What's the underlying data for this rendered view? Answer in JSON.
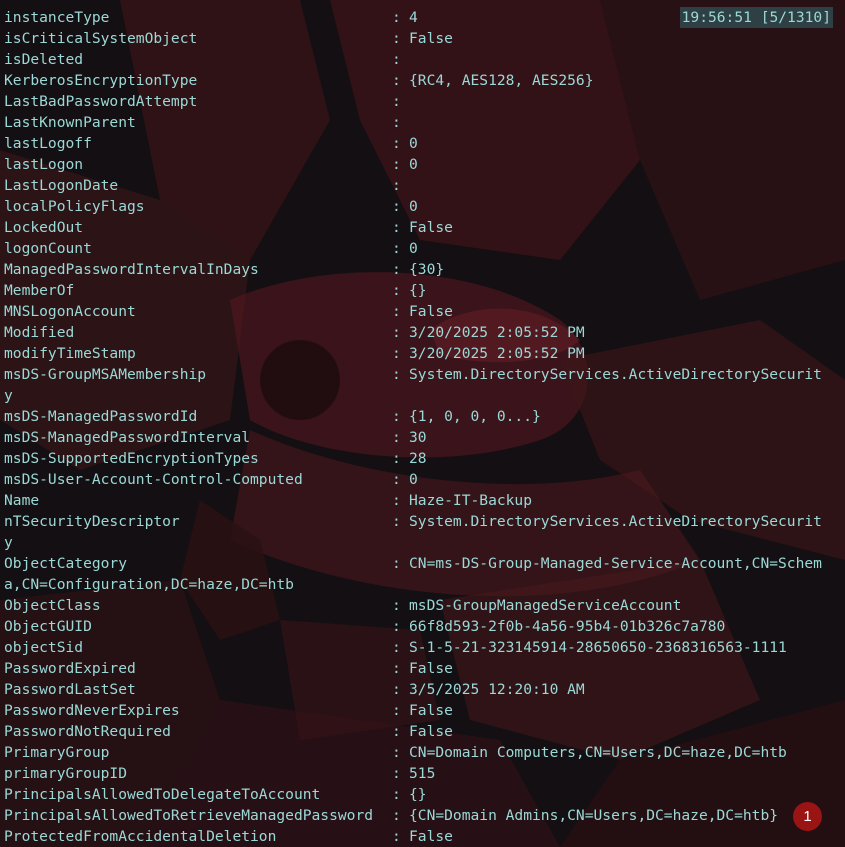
{
  "status_clock": "19:56:51 [5/1310]",
  "rows": [
    {
      "key": "instanceType",
      "sep": ":",
      "value": "4"
    },
    {
      "key": "isCriticalSystemObject",
      "sep": ":",
      "value": "False"
    },
    {
      "key": "isDeleted",
      "sep": ":",
      "value": ""
    },
    {
      "key": "KerberosEncryptionType",
      "sep": ":",
      "value": "{RC4, AES128, AES256}"
    },
    {
      "key": "LastBadPasswordAttempt",
      "sep": ":",
      "value": ""
    },
    {
      "key": "LastKnownParent",
      "sep": ":",
      "value": ""
    },
    {
      "key": "lastLogoff",
      "sep": ":",
      "value": "0"
    },
    {
      "key": "lastLogon",
      "sep": ":",
      "value": "0"
    },
    {
      "key": "LastLogonDate",
      "sep": ":",
      "value": ""
    },
    {
      "key": "localPolicyFlags",
      "sep": ":",
      "value": "0"
    },
    {
      "key": "LockedOut",
      "sep": ":",
      "value": "False"
    },
    {
      "key": "logonCount",
      "sep": ":",
      "value": "0"
    },
    {
      "key": "ManagedPasswordIntervalInDays",
      "sep": ":",
      "value": "{30}"
    },
    {
      "key": "MemberOf",
      "sep": ":",
      "value": "{}"
    },
    {
      "key": "MNSLogonAccount",
      "sep": ":",
      "value": "False"
    },
    {
      "key": "Modified",
      "sep": ":",
      "value": "3/20/2025 2:05:52 PM"
    },
    {
      "key": "modifyTimeStamp",
      "sep": ":",
      "value": "3/20/2025 2:05:52 PM"
    },
    {
      "key": "msDS-GroupMSAMembership",
      "sep": ":",
      "value": "System.DirectoryServices.ActiveDirectorySecurit"
    },
    {
      "wrap": "y"
    },
    {
      "key": "msDS-ManagedPasswordId",
      "sep": ":",
      "value": "{1, 0, 0, 0...}"
    },
    {
      "key": "msDS-ManagedPasswordInterval",
      "sep": ":",
      "value": "30"
    },
    {
      "key": "msDS-SupportedEncryptionTypes",
      "sep": ":",
      "value": "28"
    },
    {
      "key": "msDS-User-Account-Control-Computed",
      "sep": ":",
      "value": "0"
    },
    {
      "key": "Name",
      "sep": ":",
      "value": "Haze-IT-Backup"
    },
    {
      "key": "nTSecurityDescriptor",
      "sep": ":",
      "value": "System.DirectoryServices.ActiveDirectorySecurit"
    },
    {
      "wrap": "y"
    },
    {
      "key": "ObjectCategory",
      "sep": ":",
      "value": "CN=ms-DS-Group-Managed-Service-Account,CN=Schem"
    },
    {
      "wrap": "a,CN=Configuration,DC=haze,DC=htb"
    },
    {
      "key": "ObjectClass",
      "sep": ":",
      "value": "msDS-GroupManagedServiceAccount"
    },
    {
      "key": "ObjectGUID",
      "sep": ":",
      "value": "66f8d593-2f0b-4a56-95b4-01b326c7a780"
    },
    {
      "key": "objectSid",
      "sep": ":",
      "value": "S-1-5-21-323145914-28650650-2368316563-1111"
    },
    {
      "key": "PasswordExpired",
      "sep": ":",
      "value": "False"
    },
    {
      "key": "PasswordLastSet",
      "sep": ":",
      "value": "3/5/2025 12:20:10 AM"
    },
    {
      "key": "PasswordNeverExpires",
      "sep": ":",
      "value": "False"
    },
    {
      "key": "PasswordNotRequired",
      "sep": ":",
      "value": "False"
    },
    {
      "key": "PrimaryGroup",
      "sep": ":",
      "value": "CN=Domain Computers,CN=Users,DC=haze,DC=htb"
    },
    {
      "key": "primaryGroupID",
      "sep": ":",
      "value": "515"
    },
    {
      "key": "PrincipalsAllowedToDelegateToAccount",
      "sep": ":",
      "value": "{}"
    },
    {
      "key": "PrincipalsAllowedToRetrieveManagedPassword",
      "sep": ":",
      "value": "{CN=Domain Admins,CN=Users,DC=haze,DC=htb}"
    },
    {
      "key": "ProtectedFromAccidentalDeletion",
      "sep": ":",
      "value": "False"
    }
  ],
  "annotation_marker": "1",
  "colors": {
    "background": "#140f12",
    "text": "#9bd8d6",
    "clock_bg": "#2e4043",
    "marker": "#9a1414"
  }
}
